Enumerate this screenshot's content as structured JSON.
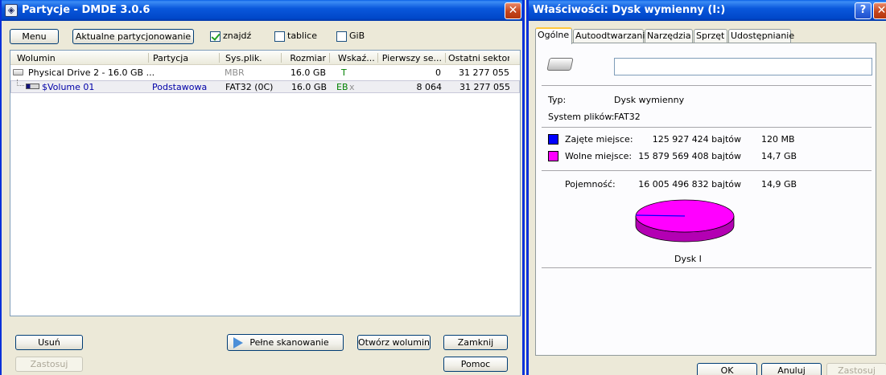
{
  "w1": {
    "title": "Partycje - DMDE 3.0.6",
    "menu_btn": "Menu",
    "current_btn": "Aktualne partycjonowanie",
    "checks": [
      {
        "label": "znajdź",
        "checked": true
      },
      {
        "label": "tablice",
        "checked": false
      },
      {
        "label": "GiB",
        "checked": false
      }
    ],
    "columns": [
      "Wolumin",
      "Partycja",
      "Sys.plik.",
      "Rozmiar",
      "Wskaź...",
      "Pierwszy se...",
      "Ostatni sektor"
    ],
    "rows": [
      {
        "volume": "Physical Drive 2 - 16.0 GB ...",
        "partition": "",
        "fs": "MBR",
        "size": "16.0 GB",
        "flags": "T",
        "flags2": "",
        "first": "0",
        "last": "31 277 055"
      },
      {
        "volume": "$Volume 01",
        "partition": "Podstawowa",
        "fs": "FAT32 (0C)",
        "size": "16.0 GB",
        "flags": "EB",
        "flags2": "x",
        "first": "8 064",
        "last": "31 277 055"
      }
    ],
    "buttons": {
      "delete": "Usuń",
      "apply": "Zastosuj",
      "full_scan": "Pełne skanowanie",
      "open_volume": "Otwórz wolumin",
      "close": "Zamknij",
      "help": "Pomoc"
    }
  },
  "w2": {
    "title": "Właściwości: Dysk wymienny (I:)",
    "help_glyph": "?",
    "close_glyph": "✕",
    "tabs": [
      "Ogólne",
      "Autoodtwarzanie",
      "Narzędzia",
      "Sprzęt",
      "Udostępnianie"
    ],
    "name_value": "",
    "type_label": "Typ:",
    "type_value": "Dysk wymienny",
    "fs_label": "System plików:",
    "fs_value": "FAT32",
    "used_label": "Zajęte miejsce:",
    "used_bytes": "125 927 424 bajtów",
    "used_human": "120 MB",
    "free_label": "Wolne miejsce:",
    "free_bytes": "15 879 569 408 bajtów",
    "free_human": "14,7 GB",
    "cap_label": "Pojemność:",
    "cap_bytes": "16 005 496 832 bajtów",
    "cap_human": "14,9 GB",
    "disk_label": "Dysk I",
    "ok": "OK",
    "cancel": "Anuluj",
    "apply": "Zastosuj",
    "used_fraction": 0.00787,
    "used_color": "#0000ff",
    "free_color": "#ff00ff"
  }
}
